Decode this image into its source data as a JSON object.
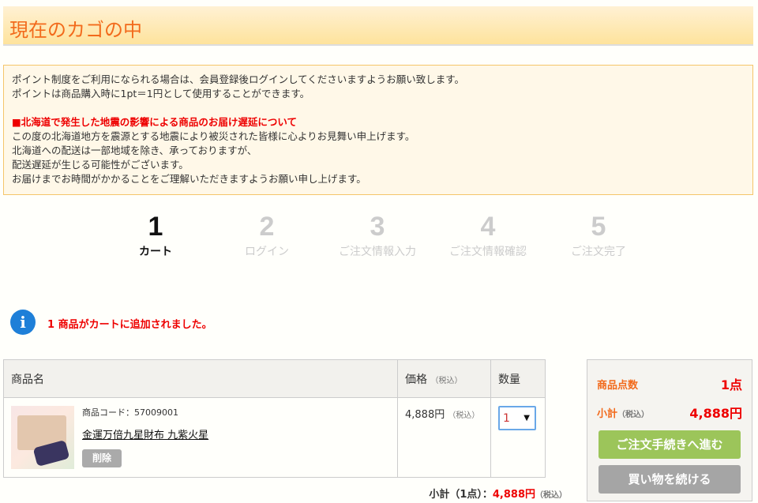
{
  "title": "現在のカゴの中",
  "notice": {
    "lines": [
      "ポイント制度をご利用になられる場合は、会員登録後ログインしてくださいますようお願い致します。",
      "ポイントは商品購入時に1pt＝1円として使用することができます。"
    ],
    "alert_title": "■北海道で発生した地震の影響による商品のお届け遅延について",
    "alert_lines": [
      "この度の北海道地方を震源とする地震により被災された皆様に心よりお見舞い申上げます。",
      "北海道への配送は一部地域を除き、承っておりますが、",
      "配送遅延が生じる可能性がございます。",
      "お届けまでお時間がかかることをご理解いただきますようお願い申し上げます。"
    ]
  },
  "steps": [
    {
      "n": "1",
      "label": "カート"
    },
    {
      "n": "2",
      "label": "ログイン"
    },
    {
      "n": "3",
      "label": "ご注文情報入力"
    },
    {
      "n": "4",
      "label": "ご注文情報確認"
    },
    {
      "n": "5",
      "label": "ご注文完了"
    }
  ],
  "message": "1 商品がカートに追加されました。",
  "table": {
    "headers": {
      "name": "商品名",
      "price": "価格",
      "qty": "数量",
      "tax": "（税込）"
    },
    "items": [
      {
        "code": "商品コード：57009001",
        "name": "金運万倍九星財布 九紫火星",
        "delete": "削除",
        "price": "4,888円",
        "tax": "（税込）",
        "qty": "1"
      }
    ]
  },
  "subtotal": {
    "label": "小計（1点）：",
    "value": "4,888円",
    "tax": "（税込）"
  },
  "summary": {
    "count_label": "商品点数",
    "count": "1点",
    "subtotal_label": "小計",
    "tax": "（税込）",
    "subtotal": "4,888円",
    "checkout": "ご注文手続きへ進む",
    "continue": "買い物を続ける"
  }
}
